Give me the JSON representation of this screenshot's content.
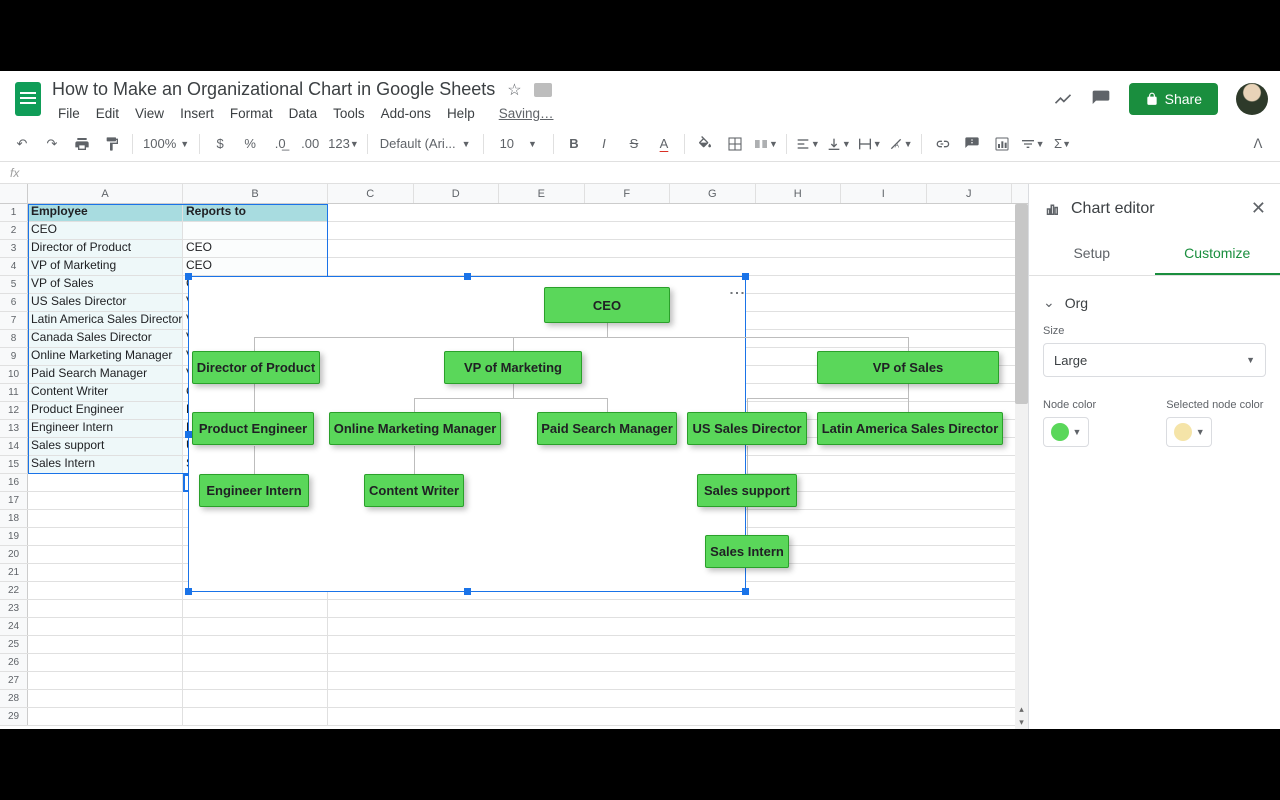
{
  "doc_title": "How to Make an Organizational Chart in Google Sheets",
  "menus": [
    "File",
    "Edit",
    "View",
    "Insert",
    "Format",
    "Data",
    "Tools",
    "Add-ons",
    "Help"
  ],
  "saving": "Saving…",
  "share": "Share",
  "zoom": "100%",
  "font": "Default (Ari...",
  "font_size": "10",
  "fx_label": "fx",
  "columns": [
    "A",
    "B",
    "C",
    "D",
    "E",
    "F",
    "G",
    "H",
    "I",
    "J"
  ],
  "headers": {
    "A": "Employee",
    "B": "Reports to"
  },
  "rows": [
    {
      "A": "CEO",
      "B": ""
    },
    {
      "A": "Director of Product",
      "B": "CEO"
    },
    {
      "A": "VP of Marketing",
      "B": "CEO"
    },
    {
      "A": "VP of Sales",
      "B": "C"
    },
    {
      "A": "US Sales Director",
      "B": "V"
    },
    {
      "A": "Latin America Sales Director",
      "B": "V"
    },
    {
      "A": "Canada Sales Director",
      "B": "V"
    },
    {
      "A": "Online Marketing Manager",
      "B": "V"
    },
    {
      "A": "Paid Search Manager",
      "B": "V"
    },
    {
      "A": "Content Writer",
      "B": "C"
    },
    {
      "A": "Product Engineer",
      "B": "D"
    },
    {
      "A": "Engineer Intern",
      "B": "P"
    },
    {
      "A": "Sales support",
      "B": "U"
    },
    {
      "A": "Sales Intern",
      "B": "S"
    }
  ],
  "empty_rows_start": 16,
  "empty_rows_end": 29,
  "chart_data": {
    "type": "org",
    "title": "",
    "nodes": [
      {
        "id": "CEO",
        "label": "CEO",
        "parent": null
      },
      {
        "id": "DOP",
        "label": "Director of Product",
        "parent": "CEO"
      },
      {
        "id": "VPM",
        "label": "VP of Marketing",
        "parent": "CEO"
      },
      {
        "id": "VPS",
        "label": "VP of Sales",
        "parent": "CEO"
      },
      {
        "id": "PE",
        "label": "Product Engineer",
        "parent": "DOP"
      },
      {
        "id": "OMM",
        "label": "Online Marketing Manager",
        "parent": "VPM"
      },
      {
        "id": "PSM",
        "label": "Paid Search Manager",
        "parent": "VPM"
      },
      {
        "id": "USD",
        "label": "US Sales Director",
        "parent": "VPS"
      },
      {
        "id": "LASD",
        "label": "Latin America Sales Director",
        "parent": "VPS"
      },
      {
        "id": "EI",
        "label": "Engineer Intern",
        "parent": "PE"
      },
      {
        "id": "CW",
        "label": "Content Writer",
        "parent": "OMM"
      },
      {
        "id": "SS",
        "label": "Sales support",
        "parent": "USD"
      },
      {
        "id": "SI",
        "label": "Sales Intern",
        "parent": "SS"
      }
    ],
    "node_color": "#5ad75a",
    "selected_node_color": "#f5e4a8"
  },
  "panel": {
    "title": "Chart editor",
    "tabs": {
      "setup": "Setup",
      "customize": "Customize"
    },
    "section": "Org",
    "size_label": "Size",
    "size_value": "Large",
    "node_color_label": "Node color",
    "sel_node_color_label": "Selected node color",
    "node_color": "#5ad75a",
    "sel_node_color": "#f5e4a8"
  }
}
